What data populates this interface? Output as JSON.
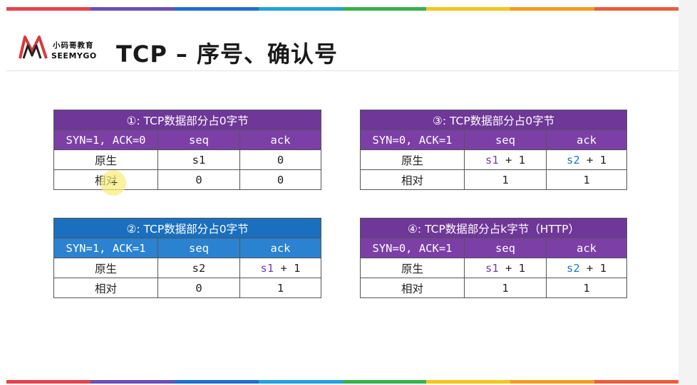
{
  "header": {
    "logo_cn": "小码哥教育",
    "logo_en": "SEEMYGO",
    "title": "TCP – 序号、确认号"
  },
  "colors": {
    "purple_header": "#7b3fa6",
    "blue_header": "#2a82d0",
    "purple_value": "#7a3aa8",
    "blue_value": "#1e72c0",
    "rainbow": [
      "#e8414a",
      "#6b4fbb",
      "#1f6fd1",
      "#1fa3e0",
      "#35b34a",
      "#f5c518",
      "#f49b1a",
      "#ef5b3a"
    ]
  },
  "tables": [
    {
      "caption": "①: TCP数据部分占0字节",
      "theme": "purple",
      "headers": [
        "SYN=1, ACK=0",
        "seq",
        "ack"
      ],
      "rows": [
        {
          "label": "原生",
          "seq": "s1",
          "seq_color": "purple",
          "ack": "0",
          "ack_color": "plain"
        },
        {
          "label": "相对",
          "seq": "0",
          "seq_color": "plain",
          "ack": "0",
          "ack_color": "plain"
        }
      ]
    },
    {
      "caption": "③: TCP数据部分占0字节",
      "theme": "purple",
      "headers": [
        "SYN=0, ACK=1",
        "seq",
        "ack"
      ],
      "rows": [
        {
          "label": "原生",
          "seq_var": "s1",
          "seq_suffix": " + 1",
          "seq_color": "purple",
          "ack_var": "s2",
          "ack_suffix": " + 1",
          "ack_color": "blue"
        },
        {
          "label": "相对",
          "seq": "1",
          "seq_color": "plain",
          "ack": "1",
          "ack_color": "plain"
        }
      ]
    },
    {
      "caption": "②: TCP数据部分占0字节",
      "theme": "blue",
      "headers": [
        "SYN=1, ACK=1",
        "seq",
        "ack"
      ],
      "rows": [
        {
          "label": "原生",
          "seq": "s2",
          "seq_color": "blue",
          "ack_var": "s1",
          "ack_suffix": " + 1",
          "ack_color": "purple"
        },
        {
          "label": "相对",
          "seq": "0",
          "seq_color": "plain",
          "ack": "1",
          "ack_color": "plain"
        }
      ]
    },
    {
      "caption": "④: TCP数据部分占k字节（HTTP）",
      "theme": "purple",
      "headers": [
        "SYN=0, ACK=1",
        "seq",
        "ack"
      ],
      "rows": [
        {
          "label": "原生",
          "seq_var": "s1",
          "seq_suffix": " + 1",
          "seq_color": "purple",
          "ack_var": "s2",
          "ack_suffix": " + 1",
          "ack_color": "blue"
        },
        {
          "label": "相对",
          "seq": "1",
          "seq_color": "plain",
          "ack": "1",
          "ack_color": "plain"
        }
      ]
    }
  ]
}
